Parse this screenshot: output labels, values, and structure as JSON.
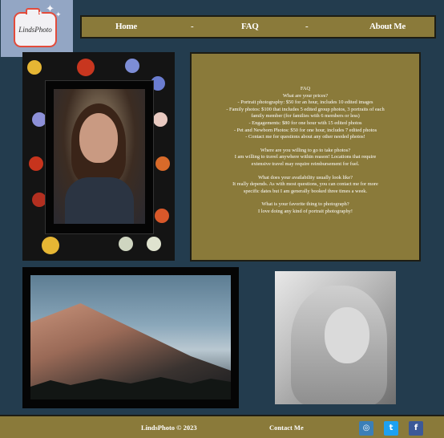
{
  "logo": {
    "brand_text": "LindsPhoto"
  },
  "nav": {
    "items": [
      "Home",
      "-",
      "FAQ",
      "-",
      "About Me"
    ]
  },
  "faq": {
    "lines": [
      "FAQ",
      "What are your prices?",
      "- Portrait photography: $50 for an hour, includes 10 edited images",
      "- Family photos: $100 that includes 5 edited group photos, 3 portraits of each",
      "family member (for families with 6 members or less)",
      "- Engagements: $80 for one hour with 15 edited photos",
      "- Pet and Newborn Photos: $50 for one hour, includes 7 edited photos",
      "- Contact me for questions about any other needed photos!",
      "Where are you willing to go to take photos?",
      "I am willing to travel anywhere within reason! Locations that require",
      "extensive travel may require reimbursement for fuel.",
      "What does your availability usually look like?",
      "It really depends. As with most questions, you can contact me for more",
      "specific dates but I am generally booked three times a week.",
      "What is your favorite thing to photograph?",
      "I love doing any kind of portrait photography!"
    ]
  },
  "footer": {
    "copyright": "LindsPhoto © 2023",
    "contact_label": "Contact Me",
    "social": [
      {
        "icon": "instagram-icon",
        "glyph": "◎",
        "color": "#3b7fb8"
      },
      {
        "icon": "twitter-icon",
        "glyph": "t",
        "color": "#1da1f2"
      },
      {
        "icon": "facebook-icon",
        "glyph": "f",
        "color": "#3b5998"
      }
    ]
  },
  "colors": {
    "background": "#233c4e",
    "panel": "#8a7a3a",
    "logo_bg": "#93a6c4"
  }
}
